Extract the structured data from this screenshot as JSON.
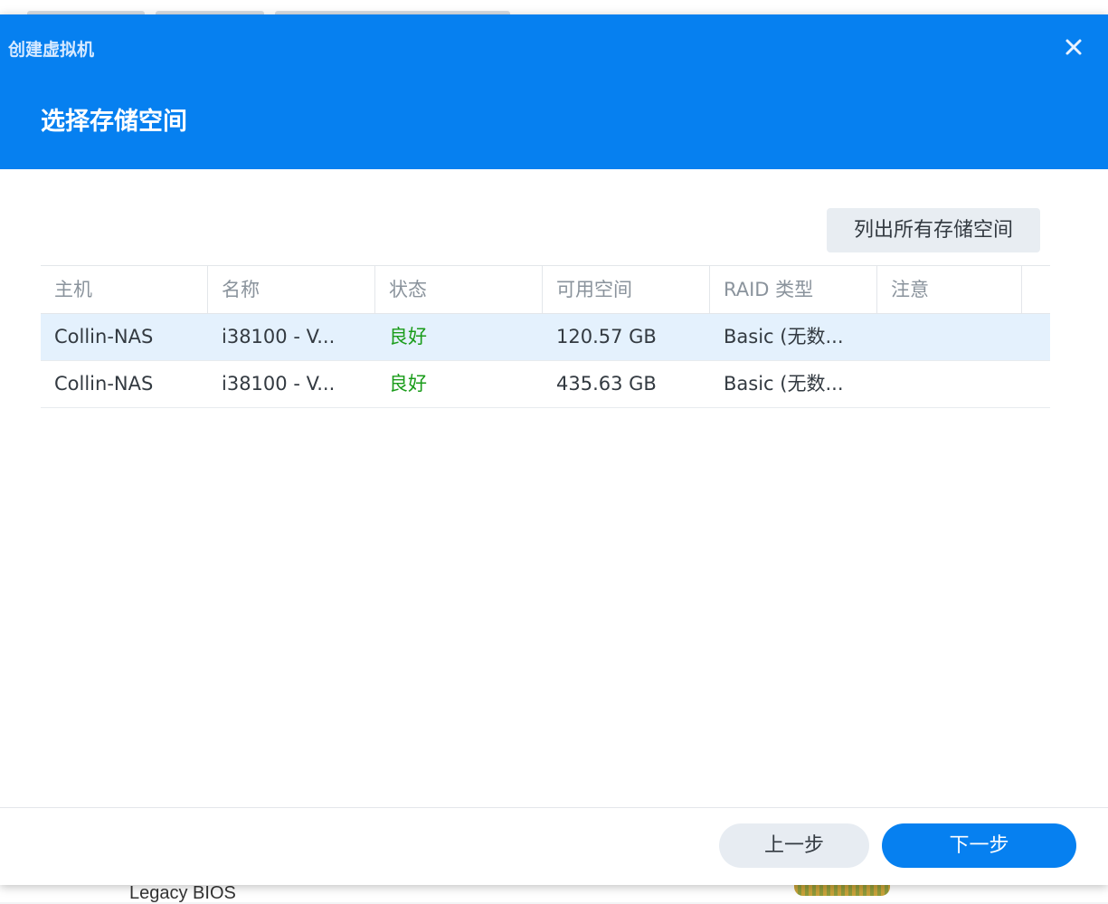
{
  "dialog": {
    "window_title": "创建虚拟机",
    "step_title": "选择存储空间",
    "close_icon": "close-icon"
  },
  "toolbar": {
    "list_all_label": "列出所有存储空间"
  },
  "table": {
    "columns": [
      "主机",
      "名称",
      "状态",
      "可用空间",
      "RAID 类型",
      "注意"
    ],
    "rows": [
      {
        "host": "Collin-NAS",
        "name": "i38100 - V...",
        "status": "良好",
        "free_space": "120.57 GB",
        "raid_type": "Basic (无数...",
        "note": ""
      },
      {
        "host": "Collin-NAS",
        "name": "i38100 - V...",
        "status": "良好",
        "free_space": "435.63 GB",
        "raid_type": "Basic (无数...",
        "note": ""
      }
    ]
  },
  "footer": {
    "prev_label": "上一步",
    "next_label": "下一步"
  },
  "background": {
    "partial_text": "Legacy BIOS"
  },
  "colors": {
    "header_bg": "#0680f0",
    "status_ok": "#1a9c1a",
    "selected_row": "#e4f1fd"
  }
}
